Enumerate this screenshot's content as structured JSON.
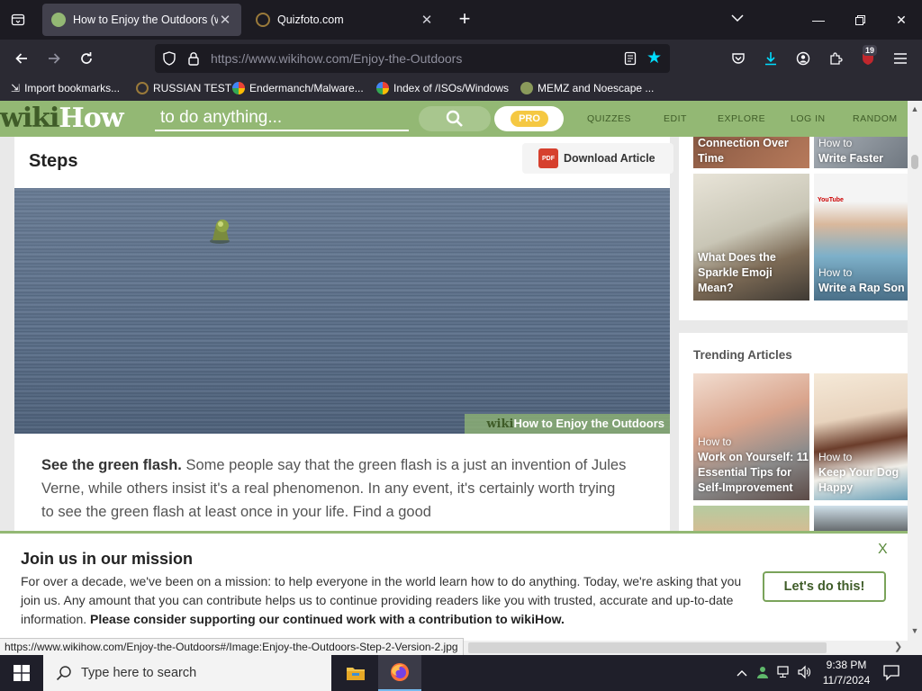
{
  "browser": {
    "tabs": [
      {
        "title": "How to Enjoy the Outdoors (wi",
        "active": true
      },
      {
        "title": "Quizfoto.com",
        "active": false
      }
    ],
    "url_host": "https://www.wikihow.com",
    "url_path": "/Enjoy-the-Outdoors",
    "extension_badge": "19",
    "bookmarks": [
      {
        "label": "Import bookmarks..."
      },
      {
        "label": "RUSSIAN TEST"
      },
      {
        "label": "Endermanch/Malware..."
      },
      {
        "label": "Index of /ISOs/Windows"
      },
      {
        "label": "MEMZ and Noescape ..."
      }
    ]
  },
  "wikihow": {
    "logo_wiki": "wiki",
    "logo_how": "How",
    "search_placeholder": "to do anything...",
    "pro_label": "PRO",
    "nav": [
      "QUIZZES",
      "EDIT",
      "EXPLORE",
      "LOG IN",
      "RANDOM"
    ]
  },
  "article": {
    "steps_heading": "Steps",
    "download_label": "Download Article",
    "pdf_icon_text": "PDF",
    "image_credit_wiki": "wiki",
    "image_credit_how": "How",
    "image_credit_rest": " to Enjoy the Outdoors",
    "step_bold": "See the green flash.",
    "step_text": " Some people say that the green flash is a just an invention of Jules Verne, while others insist it's a real phenomenon. In any event, it's certainly worth trying to see the green flash at least once in your life. Find a good"
  },
  "sidebar": {
    "related": [
      {
        "title": "Connection Over Time"
      },
      {
        "prefix": "How to",
        "title": "Write Faster"
      },
      {
        "title": "What Does the Sparkle Emoji Mean?"
      },
      {
        "prefix": "How to",
        "title": "Write a Rap Son"
      }
    ],
    "trending_heading": "Trending Articles",
    "trending": [
      {
        "prefix": "How to",
        "title": "Work on Yourself: 11 Essential Tips for Self-Improvement"
      },
      {
        "prefix": "How to",
        "title": "Keep Your Dog Happy"
      }
    ],
    "youtube_label": "YouTube"
  },
  "banner": {
    "title": "Join us in our mission",
    "close": "X",
    "body": "For over a decade, we've been on a mission: to help everyone in the world learn how to do anything. Today, we're asking that you join us. Any amount that you can contribute helps us to continue providing readers like you with trusted, accurate and up-to-date information. ",
    "body_bold": "Please consider supporting our continued work with a contribution to wikiHow.",
    "button": "Let's do this!"
  },
  "status_url": "https://www.wikihow.com/Enjoy-the-Outdoors#/Image:Enjoy-the-Outdoors-Step-2-Version-2.jpg",
  "taskbar": {
    "search_placeholder": "Type here to search",
    "time": "9:38 PM",
    "date": "11/7/2024"
  },
  "colors": {
    "wikihow_green": "#93b874",
    "firefox_dark": "#1c1b22",
    "accent_star": "#00ddff"
  }
}
